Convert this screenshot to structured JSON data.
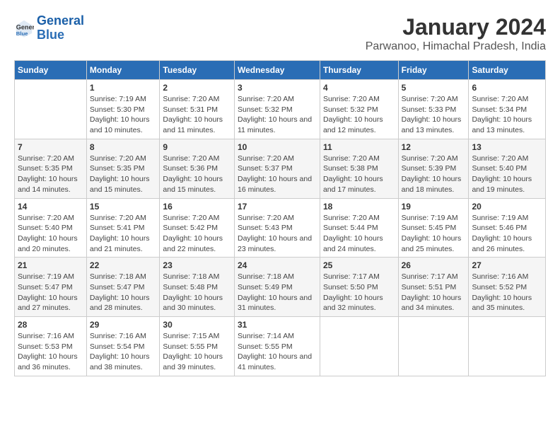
{
  "header": {
    "logo_line1": "General",
    "logo_line2": "Blue",
    "title": "January 2024",
    "subtitle": "Parwanoo, Himachal Pradesh, India"
  },
  "calendar": {
    "days_of_week": [
      "Sunday",
      "Monday",
      "Tuesday",
      "Wednesday",
      "Thursday",
      "Friday",
      "Saturday"
    ],
    "weeks": [
      [
        {
          "day": "",
          "info": ""
        },
        {
          "day": "1",
          "info": "Sunrise: 7:19 AM\nSunset: 5:30 PM\nDaylight: 10 hours\nand 10 minutes."
        },
        {
          "day": "2",
          "info": "Sunrise: 7:20 AM\nSunset: 5:31 PM\nDaylight: 10 hours\nand 11 minutes."
        },
        {
          "day": "3",
          "info": "Sunrise: 7:20 AM\nSunset: 5:32 PM\nDaylight: 10 hours\nand 11 minutes."
        },
        {
          "day": "4",
          "info": "Sunrise: 7:20 AM\nSunset: 5:32 PM\nDaylight: 10 hours\nand 12 minutes."
        },
        {
          "day": "5",
          "info": "Sunrise: 7:20 AM\nSunset: 5:33 PM\nDaylight: 10 hours\nand 13 minutes."
        },
        {
          "day": "6",
          "info": "Sunrise: 7:20 AM\nSunset: 5:34 PM\nDaylight: 10 hours\nand 13 minutes."
        }
      ],
      [
        {
          "day": "7",
          "info": "Sunrise: 7:20 AM\nSunset: 5:35 PM\nDaylight: 10 hours\nand 14 minutes."
        },
        {
          "day": "8",
          "info": "Sunrise: 7:20 AM\nSunset: 5:35 PM\nDaylight: 10 hours\nand 15 minutes."
        },
        {
          "day": "9",
          "info": "Sunrise: 7:20 AM\nSunset: 5:36 PM\nDaylight: 10 hours\nand 15 minutes."
        },
        {
          "day": "10",
          "info": "Sunrise: 7:20 AM\nSunset: 5:37 PM\nDaylight: 10 hours\nand 16 minutes."
        },
        {
          "day": "11",
          "info": "Sunrise: 7:20 AM\nSunset: 5:38 PM\nDaylight: 10 hours\nand 17 minutes."
        },
        {
          "day": "12",
          "info": "Sunrise: 7:20 AM\nSunset: 5:39 PM\nDaylight: 10 hours\nand 18 minutes."
        },
        {
          "day": "13",
          "info": "Sunrise: 7:20 AM\nSunset: 5:40 PM\nDaylight: 10 hours\nand 19 minutes."
        }
      ],
      [
        {
          "day": "14",
          "info": "Sunrise: 7:20 AM\nSunset: 5:40 PM\nDaylight: 10 hours\nand 20 minutes."
        },
        {
          "day": "15",
          "info": "Sunrise: 7:20 AM\nSunset: 5:41 PM\nDaylight: 10 hours\nand 21 minutes."
        },
        {
          "day": "16",
          "info": "Sunrise: 7:20 AM\nSunset: 5:42 PM\nDaylight: 10 hours\nand 22 minutes."
        },
        {
          "day": "17",
          "info": "Sunrise: 7:20 AM\nSunset: 5:43 PM\nDaylight: 10 hours\nand 23 minutes."
        },
        {
          "day": "18",
          "info": "Sunrise: 7:20 AM\nSunset: 5:44 PM\nDaylight: 10 hours\nand 24 minutes."
        },
        {
          "day": "19",
          "info": "Sunrise: 7:19 AM\nSunset: 5:45 PM\nDaylight: 10 hours\nand 25 minutes."
        },
        {
          "day": "20",
          "info": "Sunrise: 7:19 AM\nSunset: 5:46 PM\nDaylight: 10 hours\nand 26 minutes."
        }
      ],
      [
        {
          "day": "21",
          "info": "Sunrise: 7:19 AM\nSunset: 5:47 PM\nDaylight: 10 hours\nand 27 minutes."
        },
        {
          "day": "22",
          "info": "Sunrise: 7:18 AM\nSunset: 5:47 PM\nDaylight: 10 hours\nand 28 minutes."
        },
        {
          "day": "23",
          "info": "Sunrise: 7:18 AM\nSunset: 5:48 PM\nDaylight: 10 hours\nand 30 minutes."
        },
        {
          "day": "24",
          "info": "Sunrise: 7:18 AM\nSunset: 5:49 PM\nDaylight: 10 hours\nand 31 minutes."
        },
        {
          "day": "25",
          "info": "Sunrise: 7:17 AM\nSunset: 5:50 PM\nDaylight: 10 hours\nand 32 minutes."
        },
        {
          "day": "26",
          "info": "Sunrise: 7:17 AM\nSunset: 5:51 PM\nDaylight: 10 hours\nand 34 minutes."
        },
        {
          "day": "27",
          "info": "Sunrise: 7:16 AM\nSunset: 5:52 PM\nDaylight: 10 hours\nand 35 minutes."
        }
      ],
      [
        {
          "day": "28",
          "info": "Sunrise: 7:16 AM\nSunset: 5:53 PM\nDaylight: 10 hours\nand 36 minutes."
        },
        {
          "day": "29",
          "info": "Sunrise: 7:16 AM\nSunset: 5:54 PM\nDaylight: 10 hours\nand 38 minutes."
        },
        {
          "day": "30",
          "info": "Sunrise: 7:15 AM\nSunset: 5:55 PM\nDaylight: 10 hours\nand 39 minutes."
        },
        {
          "day": "31",
          "info": "Sunrise: 7:14 AM\nSunset: 5:55 PM\nDaylight: 10 hours\nand 41 minutes."
        },
        {
          "day": "",
          "info": ""
        },
        {
          "day": "",
          "info": ""
        },
        {
          "day": "",
          "info": ""
        }
      ]
    ]
  }
}
